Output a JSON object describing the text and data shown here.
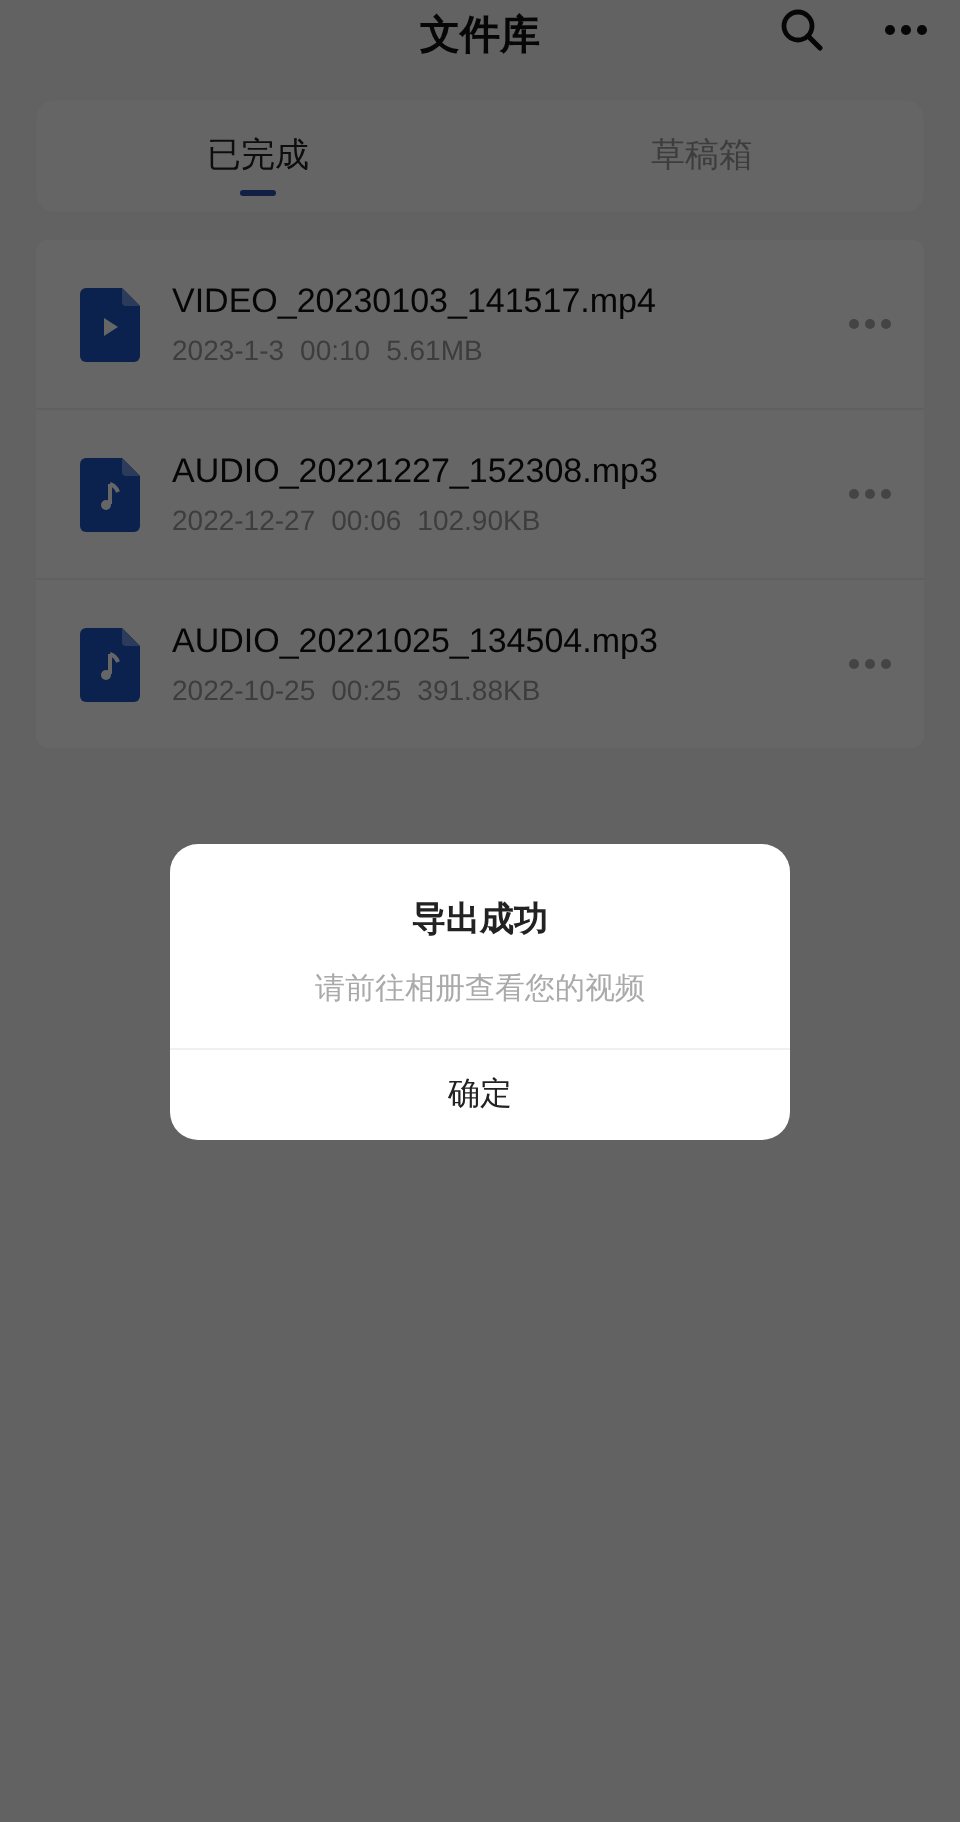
{
  "header": {
    "title": "文件库"
  },
  "tabs": [
    {
      "label": "已完成",
      "selected": true
    },
    {
      "label": "草稿箱",
      "selected": false
    }
  ],
  "files": [
    {
      "kind": "video",
      "name": "VIDEO_20230103_141517.mp4",
      "date": "2023-1-3",
      "duration": "00:10",
      "size": "5.61MB"
    },
    {
      "kind": "audio",
      "name": "AUDIO_20221227_152308.mp3",
      "date": "2022-12-27",
      "duration": "00:06",
      "size": "102.90KB"
    },
    {
      "kind": "audio",
      "name": "AUDIO_20221025_134504.mp3",
      "date": "2022-10-25",
      "duration": "00:25",
      "size": "391.88KB"
    }
  ],
  "dialog": {
    "title": "导出成功",
    "message": "请前往相册查看您的视频",
    "button": "确定"
  }
}
